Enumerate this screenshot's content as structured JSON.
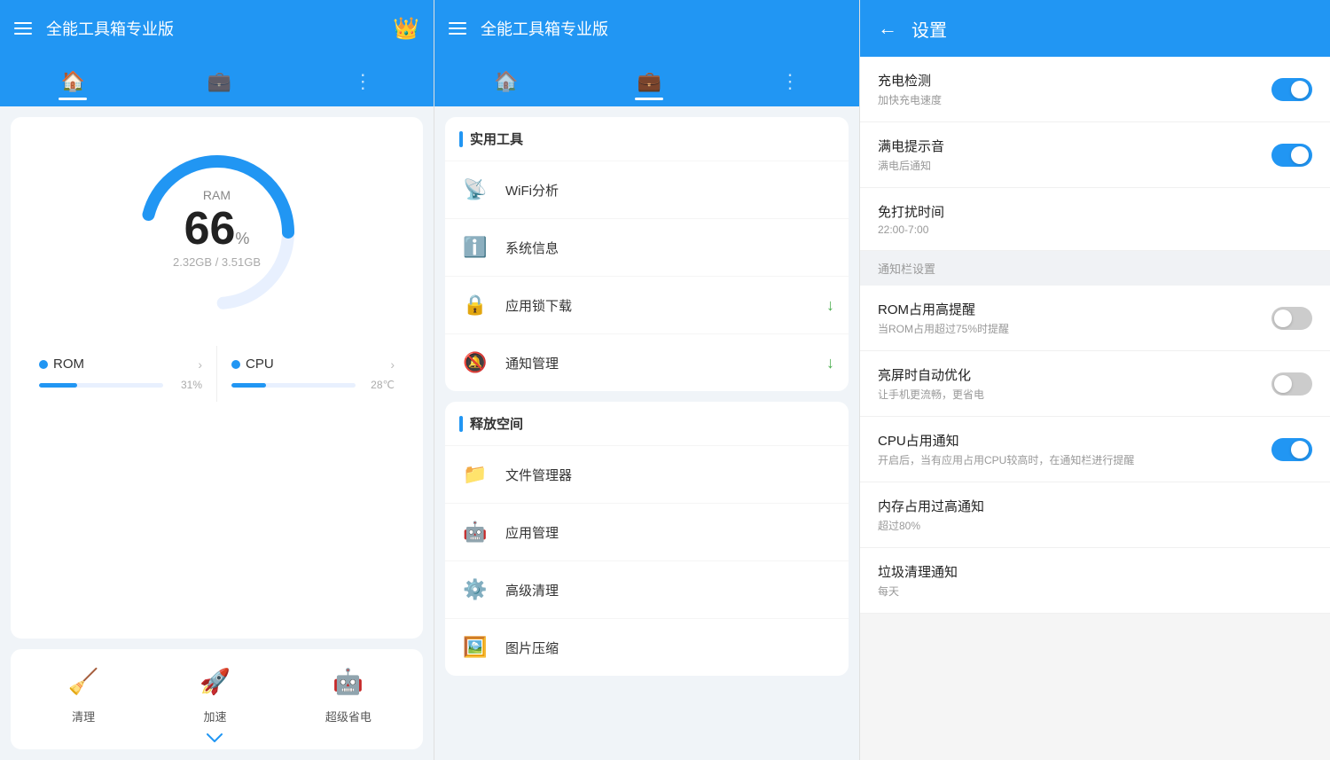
{
  "panel1": {
    "header": {
      "title": "全能工具箱专业版",
      "crown_icon": "👑"
    },
    "tabs": [
      {
        "label": "home",
        "icon": "🏠",
        "active": true
      },
      {
        "label": "tools",
        "icon": "💼",
        "active": false
      },
      {
        "label": "more",
        "icon": "⋮",
        "active": false
      }
    ],
    "gauge": {
      "title": "RAM",
      "value": "66",
      "unit": "%",
      "sub": "2.32GB / 3.51GB",
      "percent": 66
    },
    "stats": [
      {
        "label": "ROM",
        "dot_color": "#2196f3",
        "percent": 31,
        "percent_text": "31%"
      },
      {
        "label": "CPU",
        "dot_color": "#2196f3",
        "percent": 28,
        "percent_text": "28℃"
      }
    ],
    "bottom_actions": [
      {
        "label": "清理",
        "icon": "🧹"
      },
      {
        "label": "加速",
        "icon": "🚀"
      },
      {
        "label": "超级省电",
        "icon": "🤖"
      }
    ]
  },
  "panel2": {
    "header": {
      "title": "全能工具箱专业版"
    },
    "tabs": [
      {
        "label": "home",
        "icon": "🏠",
        "active": false
      },
      {
        "label": "tools",
        "icon": "💼",
        "active": true
      },
      {
        "label": "more",
        "icon": "⋮",
        "active": false
      }
    ],
    "sections": [
      {
        "title": "实用工具",
        "items": [
          {
            "icon": "📡",
            "label": "WiFi分析",
            "badge": null
          },
          {
            "icon": "ℹ️",
            "label": "系统信息",
            "badge": null
          },
          {
            "icon": "🔒",
            "label": "应用锁下载",
            "badge": "↓"
          },
          {
            "icon": "🔔",
            "label": "通知管理",
            "badge": "↓"
          }
        ]
      },
      {
        "title": "释放空间",
        "items": [
          {
            "icon": "📁",
            "label": "文件管理器",
            "badge": null
          },
          {
            "icon": "🤖",
            "label": "应用管理",
            "badge": null
          },
          {
            "icon": "⚙️",
            "label": "高级清理",
            "badge": null
          },
          {
            "icon": "🖼️",
            "label": "图片压缩",
            "badge": null
          }
        ]
      }
    ]
  },
  "panel3": {
    "header": {
      "title": "设置"
    },
    "settings": [
      {
        "type": "item",
        "name": "充电检测",
        "desc": "加快充电速度",
        "toggle": "on"
      },
      {
        "type": "item",
        "name": "满电提示音",
        "desc": "满电后通知",
        "toggle": "on"
      },
      {
        "type": "item",
        "name": "免打扰时间",
        "desc": "22:00-7:00",
        "toggle": null
      },
      {
        "type": "divider",
        "label": "通知栏设置"
      },
      {
        "type": "item",
        "name": "ROM占用高提醒",
        "desc": "当ROM占用超过75%时提醒",
        "toggle": "off"
      },
      {
        "type": "item",
        "name": "亮屏时自动优化",
        "desc": "让手机更流畅，更省电",
        "toggle": "off"
      },
      {
        "type": "item",
        "name": "CPU占用通知",
        "desc": "开启后，当有应用占用CPU较高时，在通知栏进行提醒",
        "toggle": "on"
      },
      {
        "type": "item",
        "name": "内存占用过高通知",
        "desc": "超过80%",
        "toggle": null
      },
      {
        "type": "item",
        "name": "垃圾清理通知",
        "desc": "每天",
        "toggle": null
      }
    ]
  }
}
